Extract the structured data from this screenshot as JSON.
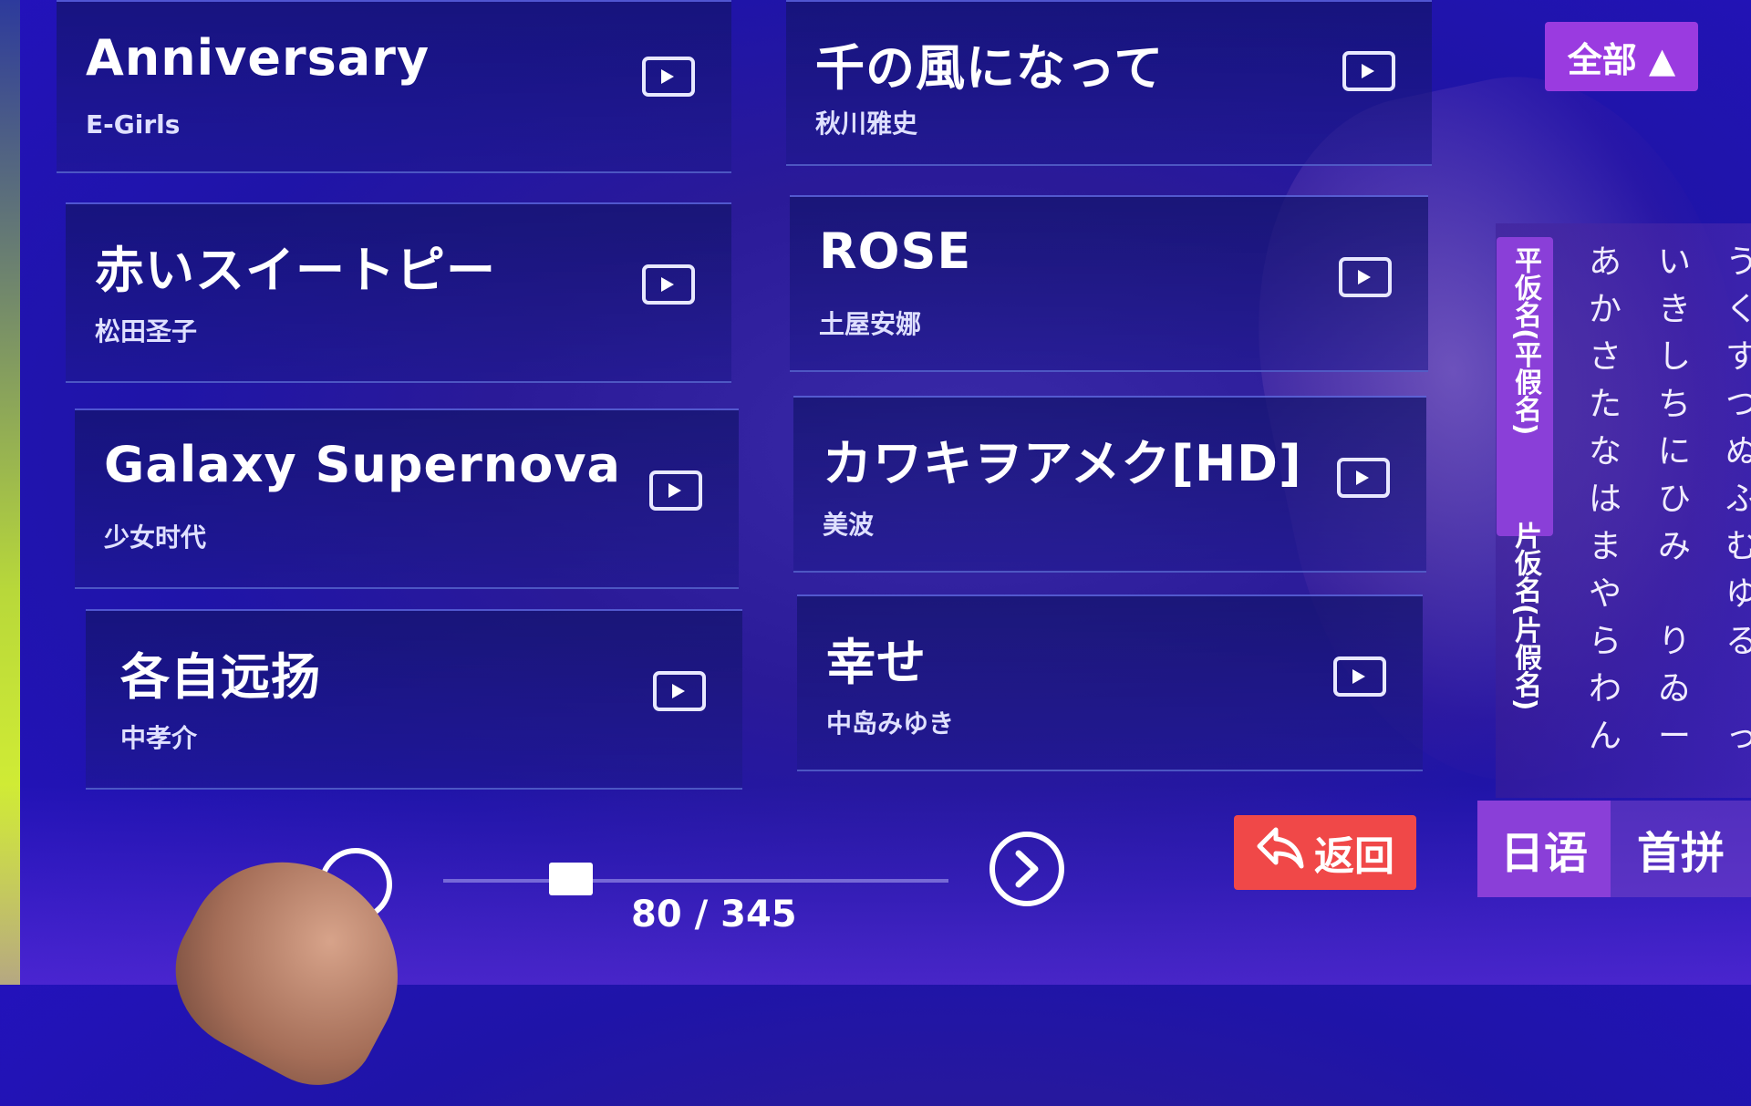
{
  "header": {
    "all_button": "全部 ▲"
  },
  "songs": [
    {
      "title": "Anniversary",
      "artist": "E-Girls"
    },
    {
      "title": "千の風になって",
      "artist": "秋川雅史"
    },
    {
      "title": "赤いスイートピー",
      "artist": "松田圣子"
    },
    {
      "title": "ROSE",
      "artist": "土屋安娜"
    },
    {
      "title": "Galaxy Supernova",
      "artist": "少女时代"
    },
    {
      "title": "カワキヲアメク[HD]",
      "artist": "美波"
    },
    {
      "title": "各自远扬",
      "artist": "中孝介"
    },
    {
      "title": "幸せ",
      "artist": "中岛みゆき"
    }
  ],
  "kana_filter": {
    "hiragana_tab": "平仮名(平假名)",
    "katakana_tab": "片仮名(片假名)",
    "columns": [
      [
        "あ",
        "か",
        "さ",
        "た",
        "な",
        "は",
        "ま",
        "や",
        "ら",
        "わ",
        "ん"
      ],
      [
        "い",
        "き",
        "し",
        "ち",
        "に",
        "ひ",
        "み",
        "",
        "り",
        "ゐ",
        "ー"
      ],
      [
        "う",
        "く",
        "す",
        "つ",
        "ぬ",
        "ふ",
        "む",
        "ゆ",
        "る",
        "",
        "っ"
      ]
    ]
  },
  "language_tabs": {
    "japanese": "日语",
    "pinyin": "首拼"
  },
  "back_button": "返回",
  "pagination": {
    "current": 80,
    "total": 345,
    "label": "80 / 345"
  },
  "icons": {
    "play": "play-icon",
    "next": "chevron-right-icon",
    "back": "back-arrow-icon"
  },
  "colors": {
    "accent_purple": "#8a3fd8",
    "back_red": "#f04848",
    "background": "#2a1a98"
  }
}
